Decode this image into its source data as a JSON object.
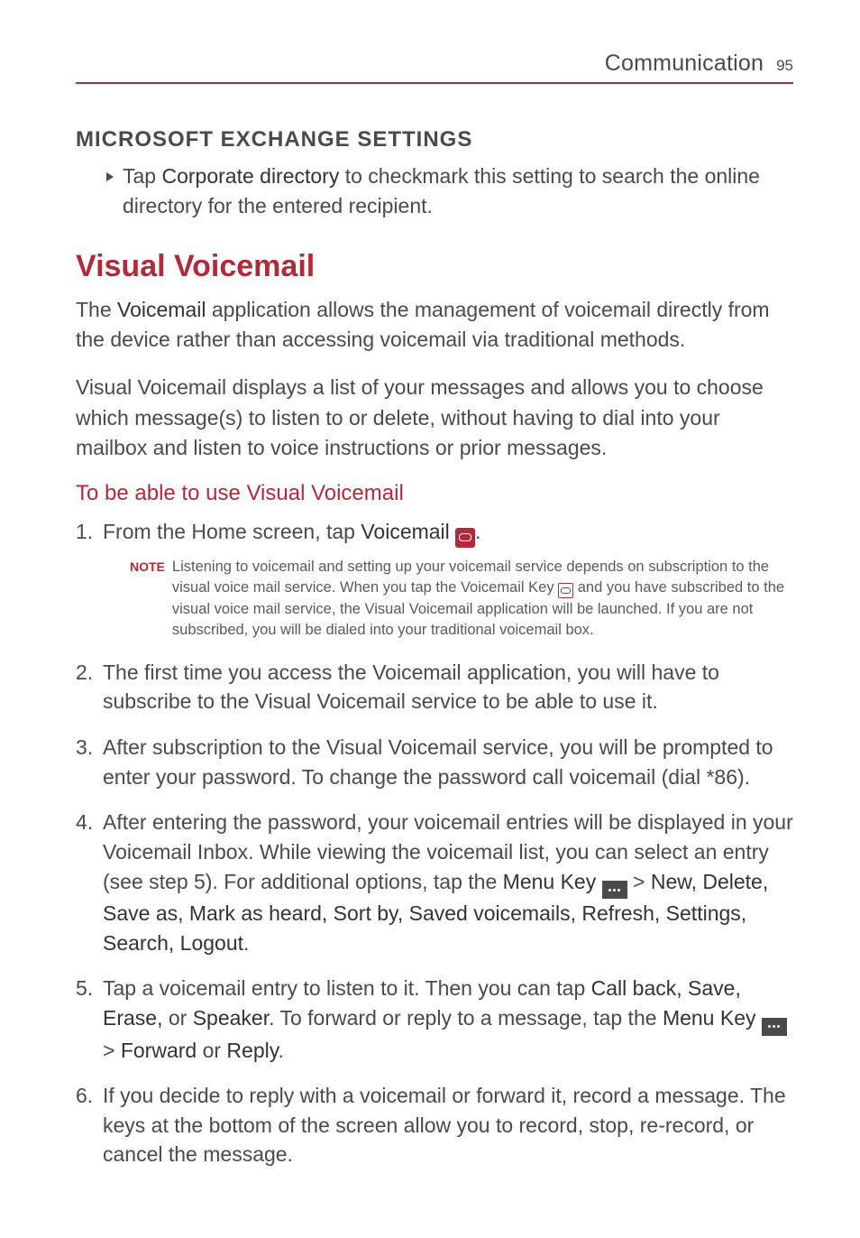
{
  "header": {
    "section": "Communication",
    "page": "95"
  },
  "ms_exchange": {
    "heading": "MICROSOFT EXCHANGE SETTINGS",
    "bullet_prefix": "Tap ",
    "bullet_term": "Corporate directory",
    "bullet_rest": " to checkmark this setting to search the online directory for the entered recipient."
  },
  "vv": {
    "title": "Visual Voicemail",
    "p1a": "The ",
    "p1b": "Voicemail",
    "p1c": " application allows the management of voicemail directly from the device rather than accessing voicemail via traditional methods.",
    "p2": "Visual Voicemail displays a list of your messages and allows you to choose which message(s) to listen to or delete, without having to dial into your mailbox and listen to voice instructions or prior messages.",
    "subhead": "To be able to use Visual Voicemail"
  },
  "steps": {
    "s1a": "From the Home screen, tap ",
    "s1b": "Voicemail ",
    "s1c": ".",
    "note_label": "NOTE",
    "note_a": "Listening to voicemail and setting up your voicemail service depends on subscription to the visual voice mail service. When you tap the Voicemail Key ",
    "note_b": " and you have subscribed to the visual voice mail service, the Visual Voicemail application will be launched. If you are not subscribed, you will be dialed into your traditional voicemail box.",
    "s2": "The first time you access the Voicemail application, you will have to subscribe to the Visual Voicemail service to be able to use it.",
    "s3": "After subscription to the Visual Voicemail service, you will be prompted to enter your password. To change the password call voicemail (dial *86).",
    "s4a": "After entering the password, your voicemail entries will be displayed in your Voicemail Inbox. While viewing the voicemail list, you can select an entry (see step 5). For additional options, tap the ",
    "s4_menu": "Menu Key ",
    "s4b": " > ",
    "s4_opts": "New, Delete, Save as, Mark as heard, Sort by, Saved voicemails, Refresh, Settings, Search, Logout",
    "s4c": ".",
    "s5a": "Tap a voicemail entry to listen to it. Then you can tap ",
    "s5_opts1": "Call back, Save, Erase,",
    "s5_or": " or ",
    "s5_speaker": "Speaker",
    "s5b": ". To forward or reply to a message, tap the ",
    "s5_menu": "Menu Key ",
    "s5c": " > ",
    "s5_fr": "Forward",
    "s5_or2": " or ",
    "s5_reply": "Reply",
    "s5d": ".",
    "s6": "If you decide to reply with a voicemail or forward it, record a message. The keys at the bottom of the screen allow you to record, stop, re-record, or cancel the message."
  },
  "chart_data": null
}
